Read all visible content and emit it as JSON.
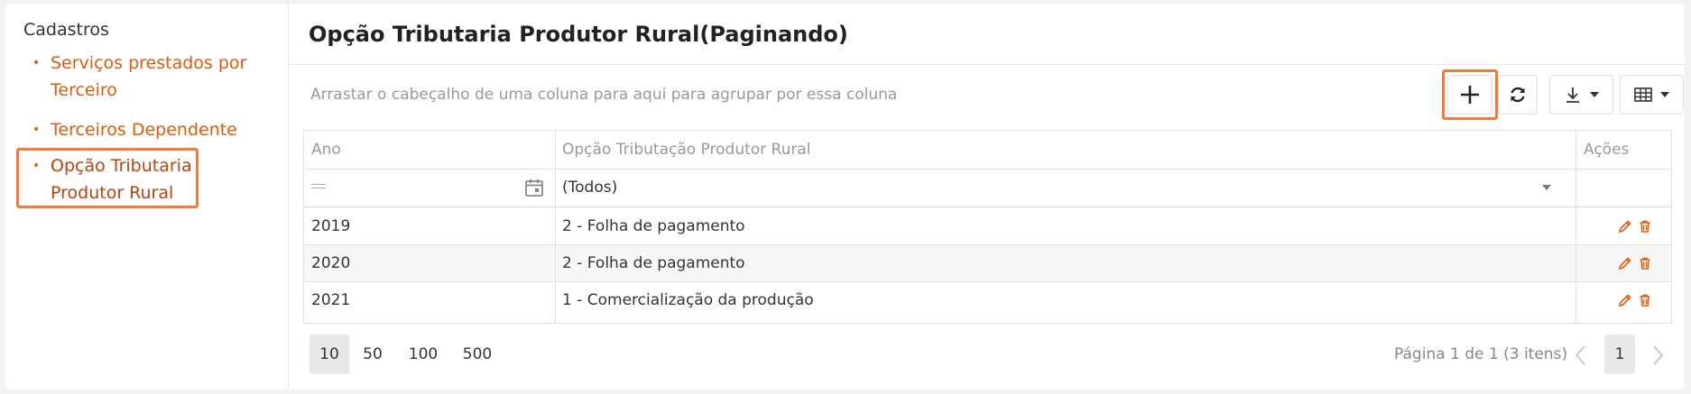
{
  "sidebar": {
    "title": "Cadastros",
    "items": [
      {
        "line1": "Serviços prestados por",
        "line2": "Terceiro"
      },
      {
        "line1": "Terceiros Dependente"
      },
      {
        "line1": "Opção Tributaria",
        "line2": "Produtor Rural"
      }
    ],
    "active_index": 2
  },
  "page": {
    "title": "Opção Tributaria Produtor Rural(Paginando)",
    "group_hint": "Arrastar o cabeçalho de uma coluna para aqui para agrupar por essa coluna"
  },
  "toolbar": {
    "icons": [
      "plus-icon",
      "refresh-icon",
      "download-icon",
      "columns-icon"
    ]
  },
  "grid": {
    "columns": [
      "Ano",
      "Opção Tributação Produtor Rural",
      "Ações"
    ],
    "filter_value": "(Todos)",
    "rows": [
      {
        "ano": "2019",
        "opcao": "2 - Folha de pagamento"
      },
      {
        "ano": "2020",
        "opcao": "2 - Folha de pagamento"
      },
      {
        "ano": "2021",
        "opcao": "1 - Comercialização da produção"
      }
    ]
  },
  "pager": {
    "sizes": [
      "10",
      "50",
      "100",
      "500"
    ],
    "selected_size": "10",
    "info": "Página 1 de 1 (3 itens)",
    "current_page": "1"
  },
  "colors": {
    "accent": "#e8590c",
    "highlight": "#f47a3c"
  }
}
